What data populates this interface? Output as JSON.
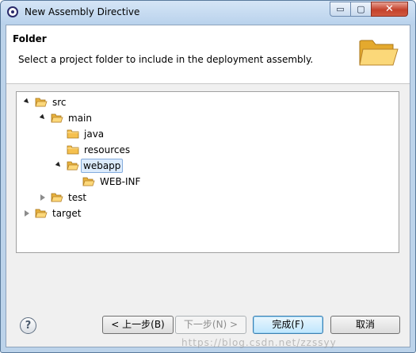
{
  "window": {
    "title": "New Assembly Directive",
    "icon": "eclipse-icon"
  },
  "title_controls": {
    "minimize": "▭",
    "maximize": "▢",
    "close": "✕"
  },
  "header": {
    "title": "Folder",
    "description": "Select a project folder to include in the deployment assembly.",
    "icon": "folder-open-icon"
  },
  "tree": [
    {
      "label": "src",
      "expanded": true
    },
    {
      "label": "main",
      "expanded": true
    },
    {
      "label": "java"
    },
    {
      "label": "resources"
    },
    {
      "label": "webapp",
      "expanded": true,
      "selected": true
    },
    {
      "label": "WEB-INF"
    },
    {
      "label": "test",
      "expanded": false
    },
    {
      "label": "target",
      "expanded": false
    }
  ],
  "buttons": {
    "back": "< 上一步(B)",
    "next": "下一步(N) >",
    "finish": "完成(F)",
    "cancel": "取消"
  },
  "help": {
    "symbol": "?"
  },
  "watermark": "https://blog.csdn.net/zzssyy",
  "colors": {
    "folder": "#f5c04e",
    "selection": "#dcebfc",
    "titlebar": "#bcd3ea"
  }
}
